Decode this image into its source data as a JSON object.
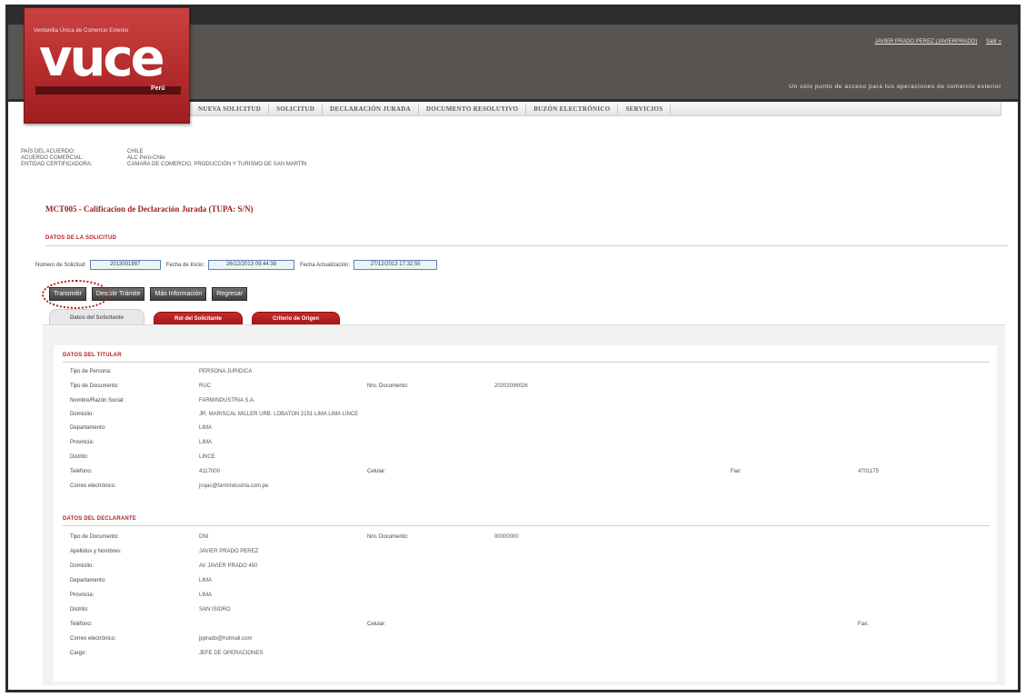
{
  "header": {
    "logo_tagline": "Ventanilla Única de Comercio Exterior",
    "logo_word": "vuce",
    "logo_country": "Perú",
    "user_name": "JAVIER PRADO PEREZ (JAVIERPRADO)",
    "logout_label": "Salir »",
    "slogan": "Un sólo punto de acceso para tus operaciones de comercio exterior",
    "menu": [
      "NUEVA SOLICITUD",
      "SOLICITUD",
      "DECLARACIÓN JURADA",
      "DOCUMENTO RESOLUTIVO",
      "BUZÓN ELECTRÓNICO",
      "SERVICIOS"
    ]
  },
  "agreement": {
    "pais_label": "PAÍS DEL ACUERDO:",
    "pais_value": "CHILE",
    "acuerdo_label": "ACUERDO COMERCIAL:",
    "acuerdo_value": "ALC Perú-Chile",
    "entidad_label": "ENTIDAD CERTIFICADORA:",
    "entidad_value": "CAMARA DE COMERCIO, PRODUCCIÓN Y TURISMO DE SAN MARTÍN"
  },
  "page_title": "MCT005 - Calificacion de Declaración Jurada (TUPA: S/N)",
  "solicitud": {
    "section_title": "DATOS DE LA SOLICITUD",
    "numero_label": "Número de Solicitud:",
    "numero_value": "2013001987",
    "inicio_label": "Fecha de Inicio:",
    "inicio_value": "26/12/2013 09:44:38",
    "actualizacion_label": "Fecha Actualización:",
    "actualizacion_value": "27/12/2013 17:32:55"
  },
  "buttons": [
    "Transmitir",
    "Desistir Trámite",
    "Más Información",
    "Regresar"
  ],
  "tabs": [
    "Datos del Solicitante",
    "Rol del Solicitante",
    "Criterio de Origen"
  ],
  "titular": {
    "section_title": "DATOS DEL TITULAR",
    "tipo_persona_label": "Tipo de Persona:",
    "tipo_persona_value": "PERSONA JURIDICA",
    "tipo_doc_label": "Tipo de Documento:",
    "tipo_doc_value": "RUC",
    "nro_doc_label": "Nro. Documento:",
    "nro_doc_value": "20202096026",
    "nombre_label": "Nombre/Razón Social:",
    "nombre_value": "FARMINDUSTRIA S.A.",
    "domicilio_label": "Domicilio:",
    "domicilio_value": "JR. MARISCAL MILLER URB. LOBATON 2151 LIMA LIMA LINCE",
    "departamento_label": "Departamento:",
    "departamento_value": "LIMA",
    "provincia_label": "Provincia:",
    "provincia_value": "LIMA",
    "distrito_label": "Distrito:",
    "distrito_value": "LINCE",
    "telefono_label": "Teléfono:",
    "telefono_value": "4117000",
    "celular_label": "Celular:",
    "fax_label": "Fax:",
    "fax_value": "4701175",
    "correo_label": "Correo electrónico:",
    "correo_value": "jrojas@farmindustria.com.pe"
  },
  "declarante": {
    "section_title": "DATOS DEL DECLARANTE",
    "tipo_doc_label": "Tipo de Documento:",
    "tipo_doc_value": "DNI",
    "nro_doc_label": "Nro. Documento:",
    "nro_doc_value": "00000000",
    "nombres_label": "Apellidos y Nombres:",
    "nombres_value": "JAVIER PRADO PEREZ",
    "domicilio_label": "Domicilio:",
    "domicilio_value": "AV JAVIER PRADO 450",
    "departamento_label": "Departamento:",
    "departamento_value": "LIMA",
    "provincia_label": "Provincia:",
    "provincia_value": "LIMA",
    "distrito_label": "Distrito:",
    "distrito_value": "SAN ISIDRO",
    "telefono_label": "Teléfono:",
    "celular_label": "Celular:",
    "fax_label": "Fax:",
    "correo_label": "Correo electrónico:",
    "correo_value": "jpprado@hotmail.com",
    "cargo_label": "Cargo:",
    "cargo_value": "JEFE DE OPERACIONES"
  },
  "colors": {
    "brand_red": "#b32a2b",
    "header_dark": "#575451",
    "section_red": "#b22222"
  }
}
